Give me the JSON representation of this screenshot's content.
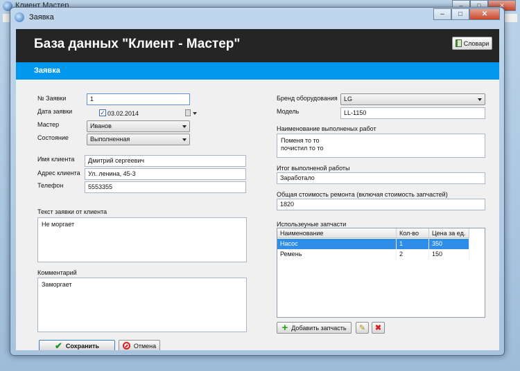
{
  "parent_window": {
    "title": "Клиент Мастер"
  },
  "dialog": {
    "title": "Заявка"
  },
  "header": {
    "app_title": "База данных \"Клиент - Мастер\"",
    "dict_button": "Словари"
  },
  "section": {
    "title": "Заявка"
  },
  "form": {
    "order_no_label": "№ Заявки",
    "order_no_value": "1",
    "date_label": "Дата заявки",
    "date_value": "03.02.2014",
    "date_checked": true,
    "master_label": "Мастер",
    "master_value": "Иванов",
    "status_label": "Состояние",
    "status_value": "Выполненная",
    "client_name_label": "Имя клиента",
    "client_name_value": "Дмитрий сергеевич",
    "client_address_label": "Адрес клиента",
    "client_address_value": "Ул. ленина, 45-3",
    "phone_label": "Телефон",
    "phone_value": "5553355",
    "request_text_label": "Текст заявки от клиента",
    "request_text_value": "Не моргает",
    "comment_label": "Комментарий",
    "comment_value": "Заморгает",
    "brand_label": "Бренд оборудования",
    "brand_value": "LG",
    "model_label": "Модель",
    "model_value": "LL-1150",
    "works_label": "Наименование выполненых работ",
    "works_value": "Поменя то то\nпочистил то то",
    "result_label": "Итог выполненой работы",
    "result_value": "Заработало",
    "cost_label": "Общая стоимость ремонта (включая стоимость запчастей)",
    "cost_value": "1820",
    "parts_label": "Использеуные запчасти"
  },
  "parts_table": {
    "columns": [
      "Наименование",
      "Кол-во",
      "Цена за ед."
    ],
    "rows": [
      {
        "name": "Насос",
        "qty": "1",
        "price": "350",
        "selected": true
      },
      {
        "name": "Ремень",
        "qty": "2",
        "price": "150",
        "selected": false
      }
    ]
  },
  "buttons": {
    "add_part": "Добавить запчасть",
    "save": "Сохранить",
    "cancel": "Отмена"
  },
  "colors": {
    "header_bg": "#252525",
    "section_bg": "#0097ee",
    "selection": "#2e8de6"
  }
}
